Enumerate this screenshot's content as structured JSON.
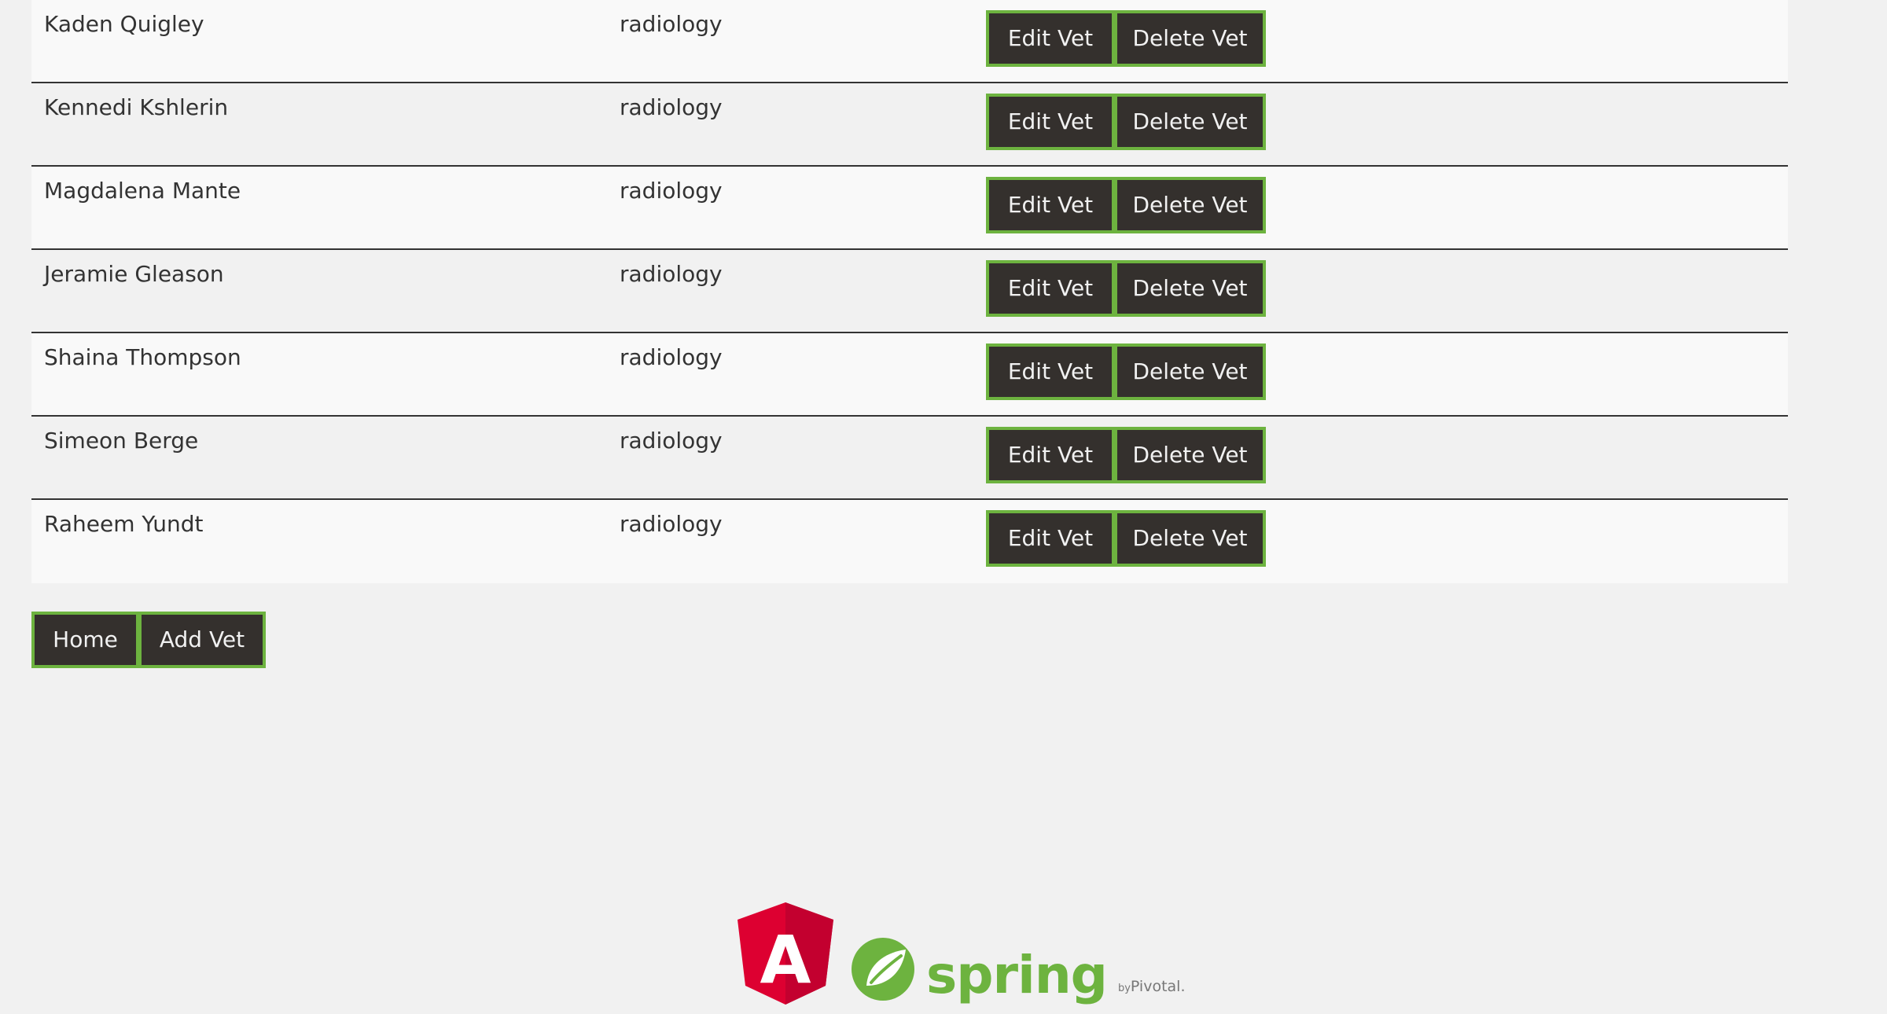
{
  "vets": [
    {
      "name": "Kaden Quigley",
      "specialty": "radiology"
    },
    {
      "name": "Kennedi Kshlerin",
      "specialty": "radiology"
    },
    {
      "name": "Magdalena Mante",
      "specialty": "radiology"
    },
    {
      "name": "Jeramie Gleason",
      "specialty": "radiology"
    },
    {
      "name": "Shaina Thompson",
      "specialty": "radiology"
    },
    {
      "name": "Simeon Berge",
      "specialty": "radiology"
    },
    {
      "name": "Raheem Yundt",
      "specialty": "radiology"
    }
  ],
  "row_actions": {
    "edit_label": "Edit Vet",
    "delete_label": "Delete Vet"
  },
  "nav": {
    "home_label": "Home",
    "add_label": "Add Vet"
  },
  "footer": {
    "angular_logo_letter": "A",
    "spring_wordmark": "spring",
    "spring_by": "by",
    "spring_company": "Pivotal."
  },
  "colors": {
    "button_bg": "#34302d",
    "button_border": "#6db33f",
    "button_text": "#f1f1f1",
    "angular_red": "#dd0031",
    "spring_green": "#6db33f"
  },
  "icons": {
    "angular_logo": "angular-logo-icon",
    "spring_leaf": "spring-leaf-icon"
  }
}
